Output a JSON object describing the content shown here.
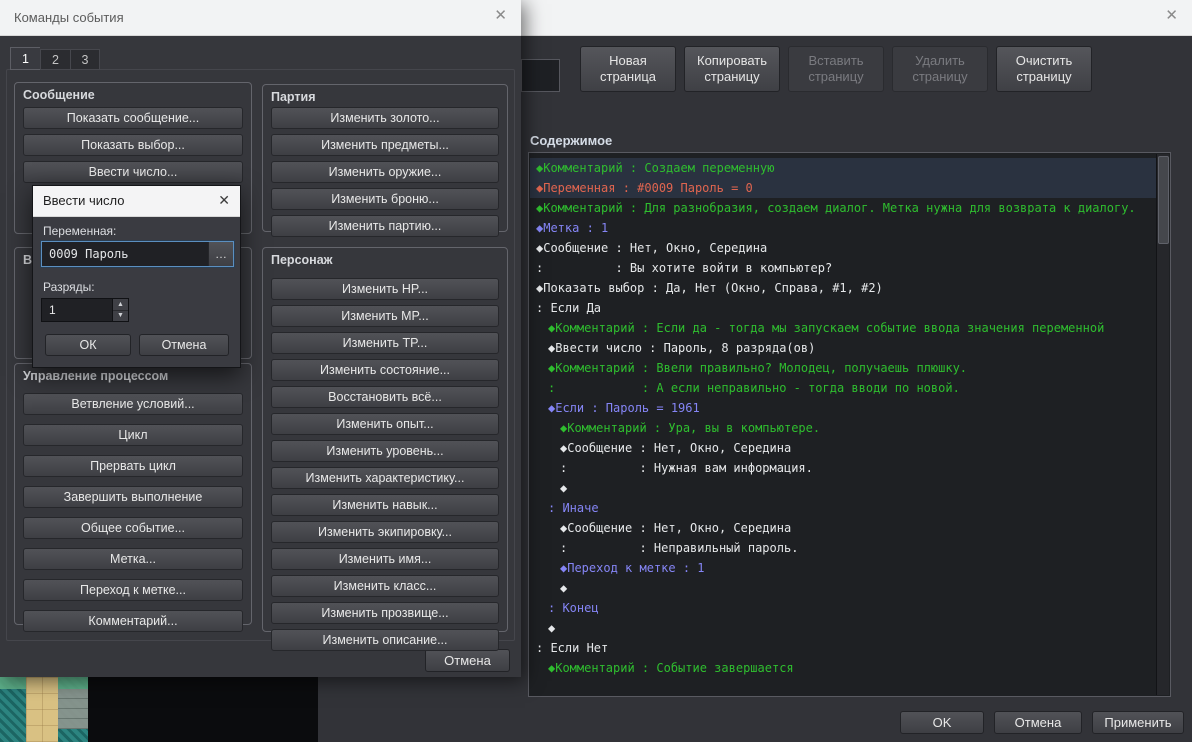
{
  "icons": {
    "close": "✕",
    "ellipsis": "…",
    "spin_up": "▲",
    "spin_down": "▼"
  },
  "commands_dialog": {
    "title": "Команды события",
    "tabs": [
      "1",
      "2",
      "3"
    ],
    "active_tab": 0,
    "groups": {
      "message": {
        "label": "Сообщение",
        "buttons": [
          "Показать сообщение...",
          "Показать выбор...",
          "Ввести число..."
        ]
      },
      "hidden_partial": {
        "label": "Вн"
      },
      "flow": {
        "label": "Управление процессом",
        "buttons": [
          "Ветвление условий...",
          "Цикл",
          "Прервать цикл",
          "Завершить выполнение",
          "Общее событие...",
          "Метка...",
          "Переход к метке...",
          "Комментарий..."
        ]
      },
      "party": {
        "label": "Партия",
        "buttons": [
          "Изменить золото...",
          "Изменить предметы...",
          "Изменить оружие...",
          "Изменить броню...",
          "Изменить партию..."
        ]
      },
      "actor": {
        "label": "Персонаж",
        "buttons": [
          "Изменить HP...",
          "Изменить MP...",
          "Изменить TP...",
          "Изменить состояние...",
          "Восстановить всё...",
          "Изменить опыт...",
          "Изменить уровень...",
          "Изменить характеристику...",
          "Изменить навык...",
          "Изменить экипировку...",
          "Изменить имя...",
          "Изменить класс...",
          "Изменить прозвище...",
          "Изменить описание..."
        ]
      }
    },
    "cancel_label": "Отмена"
  },
  "input_number_dialog": {
    "title": "Ввести число",
    "variable_label": "Переменная:",
    "variable_value": "0009 Пароль",
    "digits_label": "Разряды:",
    "digits_value": "1",
    "ok_label": "ОК",
    "cancel_label": "Отмена"
  },
  "event_editor": {
    "toolbar": [
      {
        "label": "Новая страница",
        "enabled": true
      },
      {
        "label": "Копировать страницу",
        "enabled": true
      },
      {
        "label": "Вставить страницу",
        "enabled": false
      },
      {
        "label": "Удалить страницу",
        "enabled": false
      },
      {
        "label": "Очистить страницу",
        "enabled": true
      }
    ],
    "contents_label": "Содержимое",
    "colors": {
      "green": "#2fbe2f",
      "red": "#e0654f",
      "blue": "#8585f5",
      "white": "#e6e8ea"
    },
    "rows": [
      {
        "i": 0,
        "c": "green",
        "sel": true,
        "t": "◆Комментарий : Создаем переменную"
      },
      {
        "i": 0,
        "c": "red",
        "sel": true,
        "t": "◆Переменная : #0009 Пароль = 0"
      },
      {
        "i": 0,
        "c": "green",
        "t": "◆Комментарий : Для разнобразия, создаем диалог. Метка нужна для возврата к диалогу."
      },
      {
        "i": 0,
        "c": "blue",
        "t": "◆Метка : 1"
      },
      {
        "i": 0,
        "c": "white",
        "t": "◆Сообщение : Нет, Окно, Середина"
      },
      {
        "i": 0,
        "c": "white",
        "t": ":          : Вы хотите войти в компьютер?"
      },
      {
        "i": 0,
        "c": "white",
        "t": "◆Показать выбор : Да, Нет (Окно, Справа, #1, #2)"
      },
      {
        "i": 0,
        "c": "white",
        "t": ": Если Да"
      },
      {
        "i": 1,
        "c": "green",
        "t": "◆Комментарий : Если да - тогда мы запускаем событие ввода значения переменной"
      },
      {
        "i": 1,
        "c": "white",
        "t": "◆Ввести число : Пароль, 8 разряда(ов)"
      },
      {
        "i": 1,
        "c": "green",
        "t": "◆Комментарий : Ввели правильно? Молодец, получаешь плюшку."
      },
      {
        "i": 1,
        "c": "green",
        "t": ":            : А если неправильно - тогда вводи по новой."
      },
      {
        "i": 1,
        "c": "blue",
        "t": "◆Если : Пароль = 1961"
      },
      {
        "i": 2,
        "c": "green",
        "t": "◆Комментарий : Ура, вы в компьютере."
      },
      {
        "i": 2,
        "c": "white",
        "t": "◆Сообщение : Нет, Окно, Середина"
      },
      {
        "i": 2,
        "c": "white",
        "t": ":          : Нужная вам информация."
      },
      {
        "i": 2,
        "c": "white",
        "t": "◆"
      },
      {
        "i": 1,
        "c": "blue",
        "t": ": Иначе"
      },
      {
        "i": 2,
        "c": "white",
        "t": "◆Сообщение : Нет, Окно, Середина"
      },
      {
        "i": 2,
        "c": "white",
        "t": ":          : Неправильный пароль."
      },
      {
        "i": 2,
        "c": "blue",
        "t": "◆Переход к метке : 1"
      },
      {
        "i": 2,
        "c": "white",
        "t": "◆"
      },
      {
        "i": 1,
        "c": "blue",
        "t": ": Конец"
      },
      {
        "i": 1,
        "c": "white",
        "t": "◆"
      },
      {
        "i": 0,
        "c": "white",
        "t": ": Если Нет"
      },
      {
        "i": 1,
        "c": "green",
        "t": "◆Комментарий : Событие завершается"
      }
    ],
    "buttons": {
      "ok": "OK",
      "cancel": "Отмена",
      "apply": "Применить"
    }
  }
}
